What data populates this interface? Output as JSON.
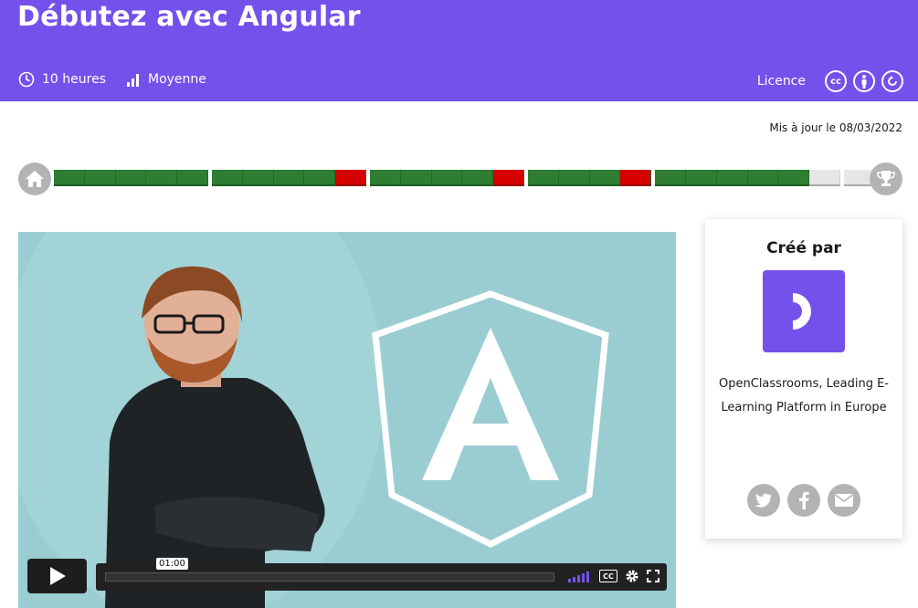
{
  "header": {
    "title": "Débutez avec Angular",
    "duration": "10 heures",
    "level": "Moyenne",
    "licence_label": "Licence",
    "licence_icons": [
      "cc-icon",
      "by-icon",
      "sa-icon"
    ],
    "background_color": "#7451eb"
  },
  "updated": "Mis à jour le 08/03/2022",
  "progress": {
    "groups": [
      {
        "done": 5,
        "fail": 0,
        "todo": 0
      },
      {
        "done": 4,
        "fail": 1,
        "todo": 0
      },
      {
        "done": 4,
        "fail": 1,
        "todo": 0
      },
      {
        "done": 3,
        "fail": 1,
        "todo": 0
      },
      {
        "done": 5,
        "fail": 0,
        "todo": 1
      }
    ],
    "extra_todo": 1,
    "colors": {
      "done": "#2e7d32",
      "fail": "#d50000",
      "todo": "#e6e6e6"
    }
  },
  "video": {
    "time": "01:00",
    "progress_fraction": 0.0,
    "icons": [
      "play-icon",
      "volume-icon",
      "captions-icon",
      "settings-icon",
      "fullscreen-icon"
    ]
  },
  "creator": {
    "heading": "Créé par",
    "name": "OpenClassrooms, Leading E-Learning Platform in Europe",
    "social": [
      "twitter-icon",
      "facebook-icon",
      "mail-icon"
    ]
  }
}
